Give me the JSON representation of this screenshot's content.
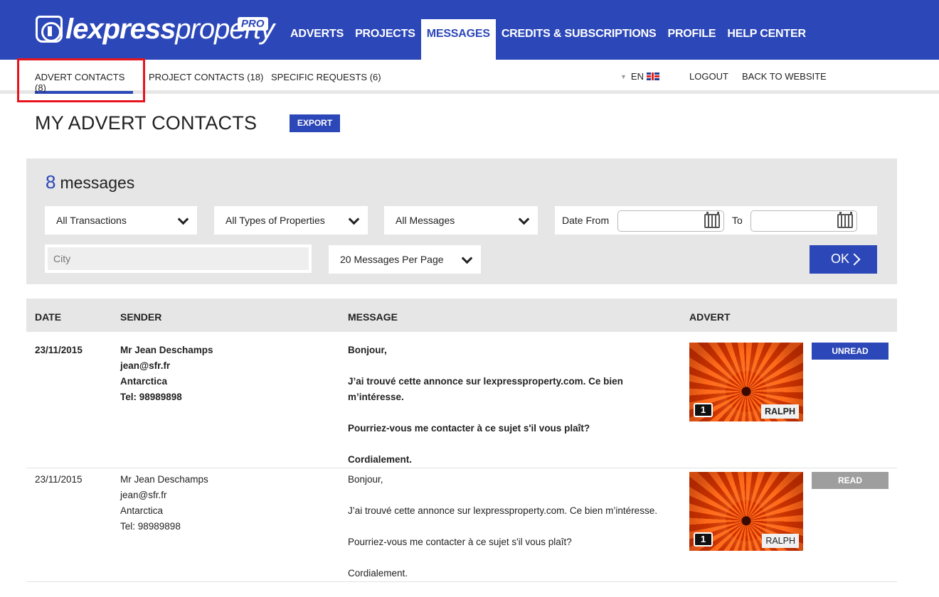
{
  "brand": {
    "name_bold": "lexpress",
    "name_light": "property",
    "badge": "PRO"
  },
  "main_nav": [
    {
      "label": "ADVERTS",
      "active": false
    },
    {
      "label": "PROJECTS",
      "active": false
    },
    {
      "label": "MESSAGES",
      "active": true
    },
    {
      "label": "CREDITS & SUBSCRIPTIONS",
      "active": false
    },
    {
      "label": "PROFILE",
      "active": false
    },
    {
      "label": "HELP CENTER",
      "active": false
    }
  ],
  "sub_nav": {
    "tabs": [
      {
        "label": "ADVERT CONTACTS (8)",
        "active": true
      },
      {
        "label": "PROJECT CONTACTS (18)",
        "active": false
      },
      {
        "label": "SPECIFIC REQUESTS (6)",
        "active": false
      }
    ],
    "language": "EN",
    "logout": "LOGOUT",
    "back": "BACK TO WEBSITE"
  },
  "page": {
    "title": "MY ADVERT CONTACTS",
    "export_label": "EXPORT"
  },
  "filters": {
    "count": "8",
    "count_label": "messages",
    "transactions": "All Transactions",
    "property_types": "All Types of Properties",
    "messages": "All Messages",
    "date_from_label": "Date From",
    "date_to_label": "To",
    "city_placeholder": "City",
    "per_page": "20 Messages Per Page",
    "ok_label": "OK"
  },
  "table": {
    "headers": {
      "date": "DATE",
      "sender": "SENDER",
      "message": "MESSAGE",
      "advert": "ADVERT"
    },
    "rows": [
      {
        "date": "23/11/2015",
        "sender_name": "Mr Jean Deschamps",
        "sender_email": "jean@sfr.fr",
        "sender_location": "Antarctica",
        "sender_tel": "Tel: 98989898",
        "msg_greeting": "Bonjour,",
        "msg_body": "J’ai trouvé cette annonce sur lexpressproperty.com. Ce bien m’intéresse.",
        "msg_request": "Pourriez-vous me contacter à ce sujet s'il vous plaît?",
        "msg_closing": "Cordialement.",
        "photo_count": "1",
        "advert_owner": "RALPH",
        "status": "UNREAD"
      },
      {
        "date": "23/11/2015",
        "sender_name": "Mr Jean Deschamps",
        "sender_email": "jean@sfr.fr",
        "sender_location": "Antarctica",
        "sender_tel": "Tel: 98989898",
        "msg_greeting": "Bonjour,",
        "msg_body": "J’ai trouvé cette annonce sur lexpressproperty.com. Ce bien m’intéresse.",
        "msg_request": "Pourriez-vous me contacter à ce sujet s'il vous plaît?",
        "msg_closing": "Cordialement.",
        "photo_count": "1",
        "advert_owner": "RALPH",
        "status": "READ"
      }
    ]
  },
  "colors": {
    "brand_blue": "#2c47b8",
    "highlight_red": "#e8141c",
    "read_gray": "#9e9e9e",
    "panel_gray": "#e6e6e6"
  },
  "icons": [
    "logo-house-icon",
    "chevron-down-icon",
    "calendar-icon",
    "chevron-right-icon",
    "camera-icon",
    "uk-flag-icon"
  ]
}
